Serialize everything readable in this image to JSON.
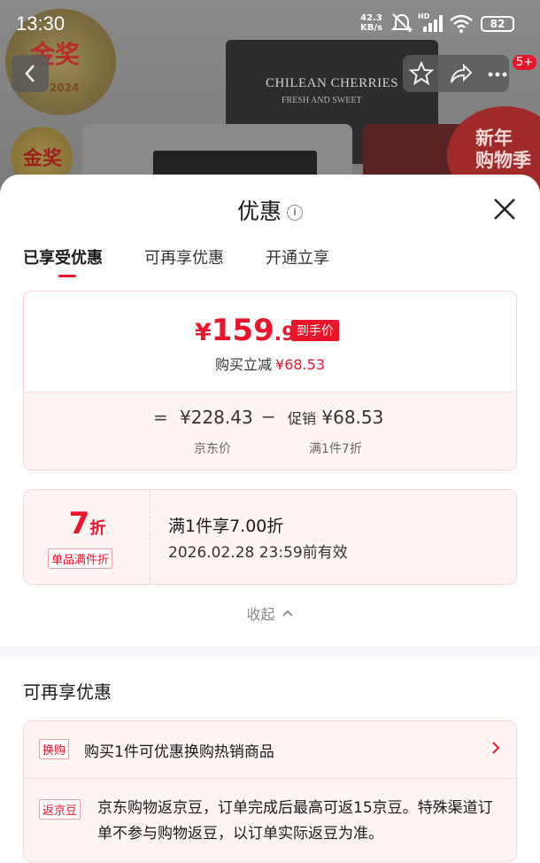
{
  "background": {
    "box_text": "CHILEAN CHERRIES",
    "box_subtext": "FRESH AND SWEET",
    "medal_text": "金奖",
    "medal_year": "2024",
    "new_year_line1": "新年",
    "new_year_line2": "购物季",
    "cart_badge": "5+"
  },
  "status_bar": {
    "time": "13:30",
    "net_speed_value": "42.3",
    "net_speed_unit": "KB/s",
    "network_label": "HD",
    "battery": "82"
  },
  "sheet": {
    "title": "优惠",
    "info_icon": "i",
    "tabs": [
      {
        "label": "已享受优惠"
      },
      {
        "label": "可再享优惠"
      },
      {
        "label": "开通立享"
      }
    ],
    "price_card": {
      "currency": "¥",
      "price_int": "159",
      "price_dec": ".9",
      "hand_price_tag": "到手价",
      "reduce_label": "购买立减",
      "reduce_amount": "¥68.53",
      "equals": "=",
      "jd_price": "¥228.43",
      "minus": "−",
      "promo_label": "促销",
      "promo_amount": "¥68.53",
      "jd_price_label": "京东价",
      "promo_sub": "满1件7折"
    },
    "discount_card": {
      "num": "7",
      "unit": "折",
      "tag": "单品满件折",
      "title": "满1件享7.00折",
      "valid": "2026.02.28 23:59前有效"
    },
    "collapse_label": "收起",
    "more_section_title": "可再享优惠",
    "more_items": [
      {
        "tag": "换购",
        "text": "购买1件可优惠换购热销商品"
      },
      {
        "tag": "返京豆",
        "text": "京东购物返京豆，订单完成后最高可返15京豆。特殊渠道订单不参与购物返豆，以订单实际返豆为准。"
      }
    ]
  },
  "colors": {
    "accent": "#e9152a",
    "card_border": "#fcd4d7",
    "card_bg": "#fff5f5"
  }
}
